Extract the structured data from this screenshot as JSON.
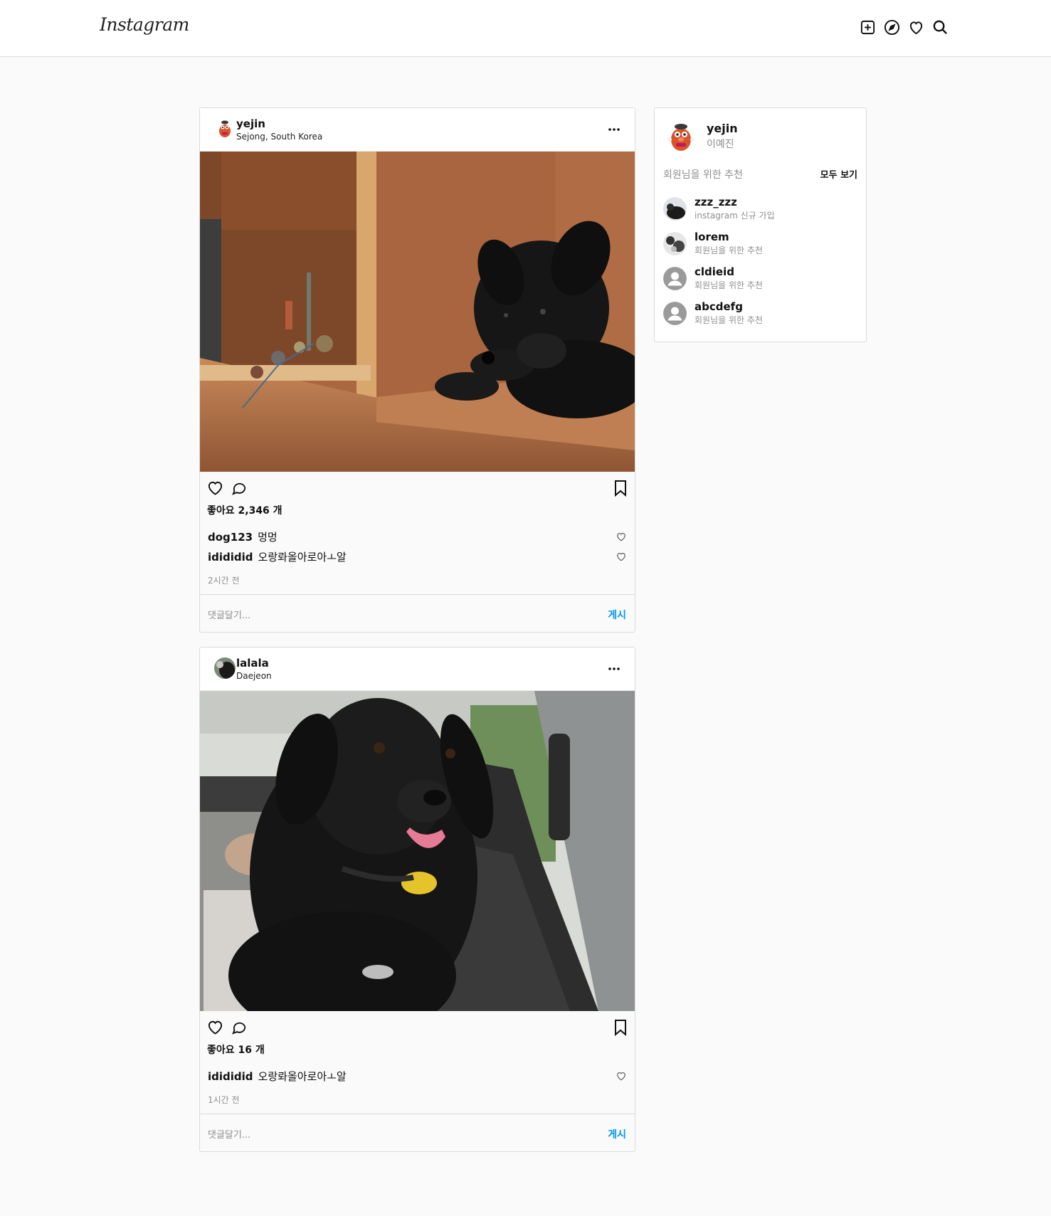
{
  "header": {
    "logo": "Instagram",
    "icons": [
      "new-post-icon",
      "explore-icon",
      "activity-heart-icon",
      "search-icon"
    ]
  },
  "posts": [
    {
      "username": "yejin",
      "location": "Sejong, South Korea",
      "likes": "좋아요 2,346 개",
      "comments": [
        {
          "user": "dog123",
          "text": "멍멍"
        },
        {
          "user": "idididid",
          "text": "오랑롸올아로아ㅗ알"
        }
      ],
      "time": "2시간 전",
      "comment_placeholder": "댓글달기...",
      "post_label": "게시"
    },
    {
      "username": "lalala",
      "location": "Daejeon",
      "likes": "좋아요 16 개",
      "comments": [
        {
          "user": "idididid",
          "text": "오랑롸올아로아ㅗ알"
        }
      ],
      "time": "1시간 전",
      "comment_placeholder": "댓글달기...",
      "post_label": "게시"
    }
  ],
  "sidebar": {
    "username": "yejin",
    "name": "이예진",
    "recommend_title": "회원님을 위한 추천",
    "see_all": "모두 보기",
    "recommendations": [
      {
        "username": "zzz_zzz",
        "sub": "instagram 신규 가입"
      },
      {
        "username": "lorem",
        "sub": "회원님을 위한 추천"
      },
      {
        "username": "cldieid",
        "sub": "회원님을 위한 추천"
      },
      {
        "username": "abcdefg",
        "sub": "회원님을 위한 추천"
      }
    ]
  },
  "colors": {
    "accent": "#0095f6",
    "border": "#dbdbdb",
    "muted": "#8e8e8e"
  }
}
